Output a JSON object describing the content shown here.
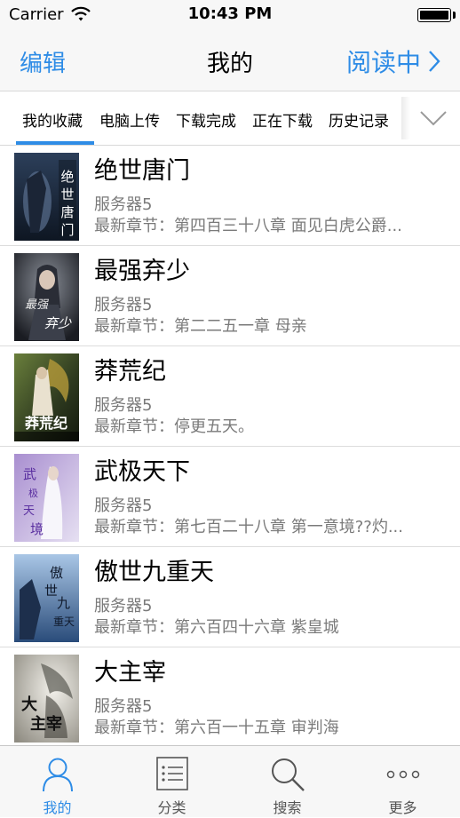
{
  "status_bar": {
    "carrier": "Carrier",
    "time": "10:43 PM"
  },
  "nav": {
    "left_label": "编辑",
    "title": "我的",
    "right_label": "阅读中"
  },
  "tabs": [
    {
      "label": "我的收藏",
      "active": true
    },
    {
      "label": "电脑上传",
      "active": false
    },
    {
      "label": "下载完成",
      "active": false
    },
    {
      "label": "正在下载",
      "active": false
    },
    {
      "label": "历史记录",
      "active": false
    }
  ],
  "books": [
    {
      "title": "绝世唐门",
      "server": "服务器5",
      "latest": "最新章节：第四百三十八章 面见白虎公爵...",
      "cover_text": "绝世唐门"
    },
    {
      "title": "最强弃少",
      "server": "服务器5",
      "latest": "最新章节：第二二五一章 母亲",
      "cover_text": "弃少"
    },
    {
      "title": "莽荒纪",
      "server": "服务器5",
      "latest": "最新章节：停更五天。",
      "cover_text": "莽荒纪"
    },
    {
      "title": "武极天下",
      "server": "服务器5",
      "latest": "最新章节：第七百二十八章 第一意境??灼...",
      "cover_text": "武极天境"
    },
    {
      "title": "傲世九重天",
      "server": "服务器5",
      "latest": "最新章节：第六百四十六章 紫皇城",
      "cover_text": "傲世九重天"
    },
    {
      "title": "大主宰",
      "server": "服务器5",
      "latest": "最新章节：第六百一十五章 审判海",
      "cover_text": "大主宰"
    }
  ],
  "tab_bar": [
    {
      "label": "我的",
      "icon": "person-icon",
      "active": true
    },
    {
      "label": "分类",
      "icon": "list-icon",
      "active": false
    },
    {
      "label": "搜索",
      "icon": "search-icon",
      "active": false
    },
    {
      "label": "更多",
      "icon": "more-icon",
      "active": false
    }
  ],
  "colors": {
    "accent": "#2e8ce6",
    "secondary_text": "#7a7a7a",
    "bar_background": "#f7f7f7"
  }
}
